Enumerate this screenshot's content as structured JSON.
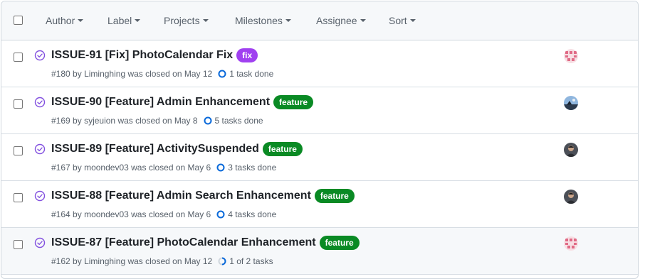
{
  "filters": [
    {
      "label": "Author"
    },
    {
      "label": "Label"
    },
    {
      "label": "Projects"
    },
    {
      "label": "Milestones"
    },
    {
      "label": "Assignee"
    },
    {
      "label": "Sort"
    }
  ],
  "issues": [
    {
      "title": "ISSUE-91 [Fix] PhotoCalendar Fix",
      "label": "fix",
      "label_color": "#a040f0",
      "number": "#180",
      "by": "by",
      "author": "Liminghing",
      "closed_text": "was closed on May 12",
      "tasks": "1 task done",
      "task_progress": 1,
      "avatar": "pink-identicon-avatar"
    },
    {
      "title": "ISSUE-90 [Feature] Admin Enhancement",
      "label": "feature",
      "label_color": "#0a8a24",
      "number": "#169",
      "by": "by",
      "author": "syjeuion",
      "closed_text": "was closed on May 8",
      "tasks": "5 tasks done",
      "task_progress": 1,
      "avatar": "landscape-photo-avatar"
    },
    {
      "title": "ISSUE-89 [Feature] ActivitySuspended",
      "label": "feature",
      "label_color": "#0a8a24",
      "number": "#167",
      "by": "by",
      "author": "moondev03",
      "closed_text": "was closed on May 6",
      "tasks": "3 tasks done",
      "task_progress": 1,
      "avatar": "person-photo-avatar"
    },
    {
      "title": "ISSUE-88 [Feature] Admin Search Enhancement",
      "label": "feature",
      "label_color": "#0a8a24",
      "number": "#164",
      "by": "by",
      "author": "moondev03",
      "closed_text": "was closed on May 6",
      "tasks": "4 tasks done",
      "task_progress": 1,
      "avatar": "person-photo-avatar"
    },
    {
      "title": "ISSUE-87 [Feature] PhotoCalendar Enhancement",
      "label": "feature",
      "label_color": "#0a8a24",
      "number": "#162",
      "by": "by",
      "author": "Liminghing",
      "closed_text": "was closed on May 12",
      "tasks": "1 of 2 tasks",
      "task_progress": 0.5,
      "avatar": "pink-identicon-avatar"
    }
  ],
  "colors": {
    "closed_icon": "#8250df",
    "task_ring": "#0969da",
    "hover_row_bg": "#f6f8fa"
  }
}
